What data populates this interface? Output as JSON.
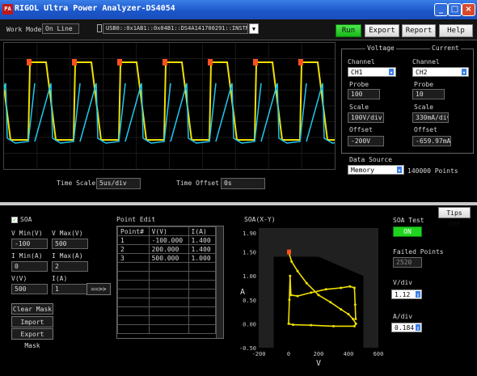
{
  "window": {
    "title": "RIGOL Ultra Power Analyzer-DS4054",
    "app_icon": "PA",
    "controls": [
      "_",
      "□",
      "×"
    ]
  },
  "toolbar": {
    "work_mode_label": "Work Mode",
    "work_mode_value": "On Line",
    "device_value": "USB0::0x1AB1::0x04B1::DS4A141700291::INSTR",
    "buttons": [
      "Run",
      "Export",
      "Report",
      "Help"
    ]
  },
  "scope": {
    "time_scale_label": "Time Scale",
    "time_scale_value": "5us/div",
    "time_offset_label": "Time Offset",
    "time_offset_value": "0s",
    "colors": {
      "voltage": "#f0e000",
      "current": "#20c8f0",
      "marker": "#ff5020"
    }
  },
  "voltage": {
    "title": "Voltage",
    "channel_label": "Channel",
    "channel_value": "CH1",
    "probe_label": "Probe",
    "probe_value": "100",
    "scale_label": "Scale",
    "scale_value": "100V/div",
    "offset_label": "Offset",
    "offset_value": "-200V"
  },
  "current": {
    "title": "Current",
    "channel_label": "Channel",
    "channel_value": "CH2",
    "probe_label": "Probe",
    "probe_value": "10",
    "scale_label": "Scale",
    "scale_value": "330mA/div",
    "offset_label": "Offset",
    "offset_value": "-659.97mA"
  },
  "data_source": {
    "label": "Data Source",
    "value": "Memory",
    "points": "140000 Points"
  },
  "tips_button": "Tips Off",
  "soa": {
    "checkbox_label": "SOA",
    "v_min_label": "V Min(V)",
    "v_min_value": "-100",
    "v_max_label": "V Max(V)",
    "v_max_value": "500",
    "i_min_label": "I Min(A)",
    "i_min_value": "0",
    "i_max_label": "I Max(A)",
    "i_max_value": "2",
    "v_label": "V(V)",
    "v_value": "500",
    "i_label": "I(A)",
    "i_value": "1",
    "arrow_button": "==>>",
    "clear_mask": "Clear Mask",
    "import_mask": "Import Mask",
    "export_mask": "Export Mask"
  },
  "point_edit": {
    "title": "Point Edit",
    "headers": [
      "Point#",
      "V(V)",
      "I(A)"
    ],
    "rows": [
      [
        "1",
        "-100.000",
        "1.400"
      ],
      [
        "2",
        "200.000",
        "1.400"
      ],
      [
        "3",
        "500.000",
        "1.000"
      ]
    ]
  },
  "soa_test": {
    "title": "SOA Test",
    "toggle": "ON",
    "failed_label": "Failed Points",
    "failed_value": "2520",
    "vdiv_label": "V/div",
    "vdiv_value": "1.12",
    "adiv_label": "A/div",
    "adiv_value": "0.184"
  },
  "chart_data": {
    "type": "scatter",
    "title": "SOA(X-Y)",
    "xlabel": "V",
    "ylabel": "A",
    "xlim": [
      -200,
      600
    ],
    "ylim": [
      -0.5,
      2.0
    ],
    "xticks": [
      "-200",
      "0",
      "200",
      "400",
      "600"
    ],
    "yticks": [
      "-0.50",
      "0.00",
      "0.50",
      "1.00",
      "1.50",
      "1.90"
    ],
    "mask": [
      [
        -100,
        1.4
      ],
      [
        200,
        1.4
      ],
      [
        500,
        1.0
      ],
      [
        500,
        -0.5
      ],
      [
        -100,
        -0.5
      ]
    ],
    "series": [
      {
        "values": [
          [
            0,
            1.5
          ],
          [
            20,
            1.3
          ],
          [
            60,
            1.1
          ],
          [
            120,
            0.85
          ],
          [
            200,
            0.6
          ],
          [
            280,
            0.45
          ],
          [
            350,
            0.3
          ],
          [
            400,
            0.2
          ],
          [
            430,
            0.1
          ],
          [
            450,
            0.0
          ],
          [
            440,
            -0.05
          ],
          [
            300,
            -0.05
          ],
          [
            150,
            -0.03
          ],
          [
            30,
            -0.02
          ],
          [
            0,
            0.0
          ],
          [
            5,
            0.5
          ],
          [
            10,
            1.0
          ],
          [
            15,
            0.6
          ],
          [
            60,
            0.58
          ],
          [
            150,
            0.65
          ],
          [
            250,
            0.72
          ],
          [
            350,
            0.75
          ],
          [
            410,
            0.78
          ],
          [
            440,
            0.75
          ],
          [
            445,
            0.4
          ],
          [
            448,
            0.1
          ]
        ]
      }
    ]
  }
}
